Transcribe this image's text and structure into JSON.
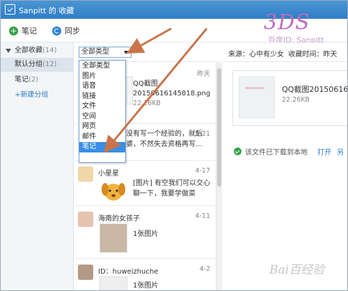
{
  "window": {
    "title": "Sanpitt 的 收藏"
  },
  "watermark": {
    "logo_text": "3DS",
    "logo_sub": "百度ID: Sanpitt",
    "baidu": "Bai百经验"
  },
  "toolbar": {
    "note_label": "笔记",
    "sync_label": "同步"
  },
  "sidebar": {
    "root_label": "全部收藏",
    "root_count": "(14)",
    "items": [
      {
        "label": "默认分组",
        "count": "(12)"
      },
      {
        "label": "笔记",
        "count": "(2)"
      }
    ],
    "new_group": "+新建分组"
  },
  "filter": {
    "selected": "全部类型",
    "options": [
      "全部类型",
      "图片",
      "语音",
      "链接",
      "文件",
      "空间",
      "网页",
      "邮件",
      "笔记"
    ],
    "highlighted": "笔记"
  },
  "list": {
    "items": [
      {
        "author": "",
        "date": "昨天",
        "title": "QQ截图",
        "subtitle": "20150616145818.png",
        "meta": "22.26KB"
      },
      {
        "author": "",
        "date": "5-21",
        "line1": "没有写一个经验的，就后",
        "line2": "婆，不然失去资格再写..."
      },
      {
        "author": "小星星",
        "date": "4-17",
        "line1": "[图片] 有空我们可以交心",
        "line2": "聊一下，我要学做菜"
      },
      {
        "author": "海南的女孩子",
        "date": "4-11",
        "line1": "1张图片"
      },
      {
        "author": "ID：huweizhuche",
        "date": "4-2",
        "line1": "1张图片"
      }
    ]
  },
  "detail": {
    "source_label": "来源：心中有少女",
    "time_label": "收藏时间：昨天",
    "file_name": "QQ截图20150616",
    "file_size": "22.26KB",
    "download_note": "该文件已下载到本地",
    "open_label": "打开",
    "more_label": "另"
  },
  "colors": {
    "titlebar": "#2f7ec6",
    "highlight": "#3a8ee6",
    "arrow": "#c9744a"
  }
}
